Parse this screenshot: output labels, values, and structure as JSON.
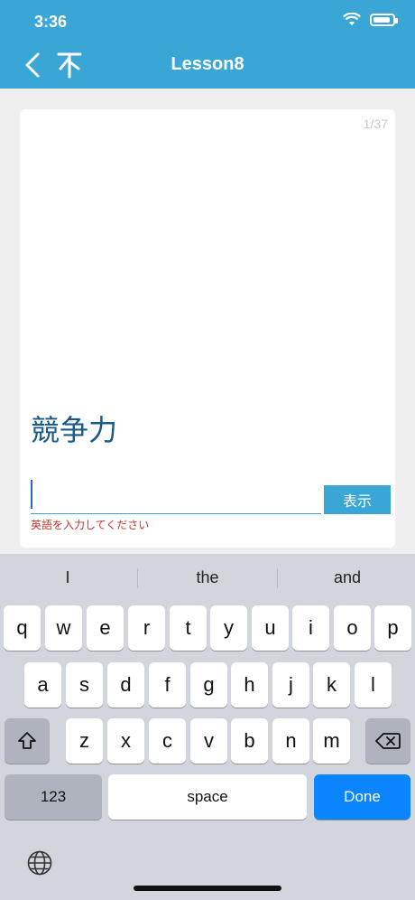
{
  "status": {
    "time": "3:36"
  },
  "nav": {
    "title": "Lesson8"
  },
  "card": {
    "counter": "1/37",
    "word": "競争力",
    "input_value": "",
    "show_label": "表示",
    "hint": "英語を入力してください"
  },
  "keyboard": {
    "suggestions": [
      "I",
      "the",
      "and"
    ],
    "row1": [
      "q",
      "w",
      "e",
      "r",
      "t",
      "y",
      "u",
      "i",
      "o",
      "p"
    ],
    "row2": [
      "a",
      "s",
      "d",
      "f",
      "g",
      "h",
      "j",
      "k",
      "l"
    ],
    "row3": [
      "z",
      "x",
      "c",
      "v",
      "b",
      "n",
      "m"
    ],
    "numbers_label": "123",
    "space_label": "space",
    "done_label": "Done"
  },
  "colors": {
    "accent": "#3aa6d6",
    "word": "#1a5a86",
    "hint": "#c3342c",
    "done": "#0a84ff"
  },
  "icons": [
    "back-arrow-icon",
    "scroll-top-icon",
    "wifi-icon",
    "battery-icon",
    "shift-icon",
    "backspace-icon",
    "globe-icon"
  ]
}
